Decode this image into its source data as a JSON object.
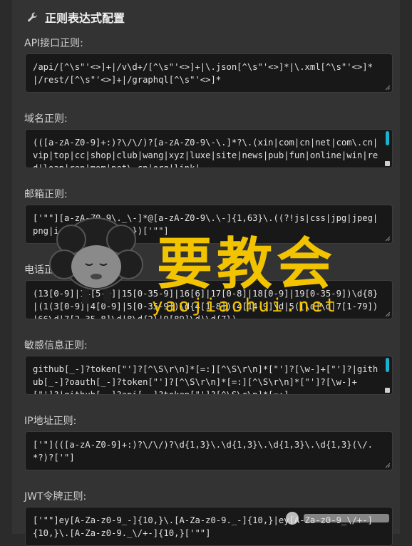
{
  "header": {
    "title": "正则表达式配置",
    "icon": "wrench-icon"
  },
  "fields": [
    {
      "label": "API接口正则:",
      "value": "/api/[^\\s\"'<>]+|/v\\d+/[^\\s\"'<>]+|\\.json[^\\s\"'<>]*|\\.xml[^\\s\"'<>]*|/rest/[^\\s\"'<>]+|/graphql[^\\s\"'<>]*"
    },
    {
      "label": "域名正则:",
      "value": "(([a-zA-Z0-9]+:)?\\/\\/)?[a-zA-Z0-9\\-\\.]*?\\.(xin|com|cn|net|com\\.cn|vip|top|cc|shop|club|wang|xyz|luxe|site|news|pub|fun|online|win|red|loan|ren|mom|net\\.cn|org|link|"
    },
    {
      "label": "邮箱正则:",
      "value": "['\"\"][a-zA-Z0-9\\._\\-]*@[a-zA-Z0-9\\.\\-]{1,63}\\.((?!js|css|jpg|jpeg|png|ico)[a-zA-Z]{2,})['\"\"]"
    },
    {
      "label": "电话正则:",
      "value": "(13[0-9]|14[5-9]|15[0-35-9]|16[6]|17[0-8]|18[0-9]|19[0-35-9])\\d{8}|(1(3[0-9]|4[0-9]|5[0-35-9])\\d{4[1-8])|4[14-9]\\d|5([\\d]\\d|7[1-79])|66\\d|7[2-35-8]\\d|8\\d{2}|9[89]\\d)\\d{7})"
    },
    {
      "label": "敏感信息正则:",
      "value": "github[_-]?token[\"']?[^\\S\\r\\n]*[=:][^\\S\\r\\n]*[\"']?[\\w-]+[\"']?|github[_-]?oauth[_-]?token[\"']?[^\\S\\r\\n]*[=:][^\\S\\r\\n]*[\"']?[\\w-]+[\"']?|github[_-]?api[_-]?token[\"']?[^\\S\\r\\n]*[=:]"
    },
    {
      "label": "IP地址正则:",
      "value": "['\"](([a-zA-Z0-9]+:)?\\/\\/)?\\d{1,3}\\.\\d{1,3}\\.\\d{1,3}\\.\\d{1,3}(\\/.*?)?['\"]"
    },
    {
      "label": "JWT令牌正则:",
      "value": "['\"\"]ey[A-Za-z0-9_-]{10,}\\.[A-Za-z0-9._-]{10,}|ey[A-Za-z0-9_\\/+-]{10,}\\.[A-Za-z0-9._\\/+-]{10,}['\"\"]"
    }
  ],
  "watermark": {
    "brand": "要教会",
    "url": "yaojiaohui.net"
  }
}
